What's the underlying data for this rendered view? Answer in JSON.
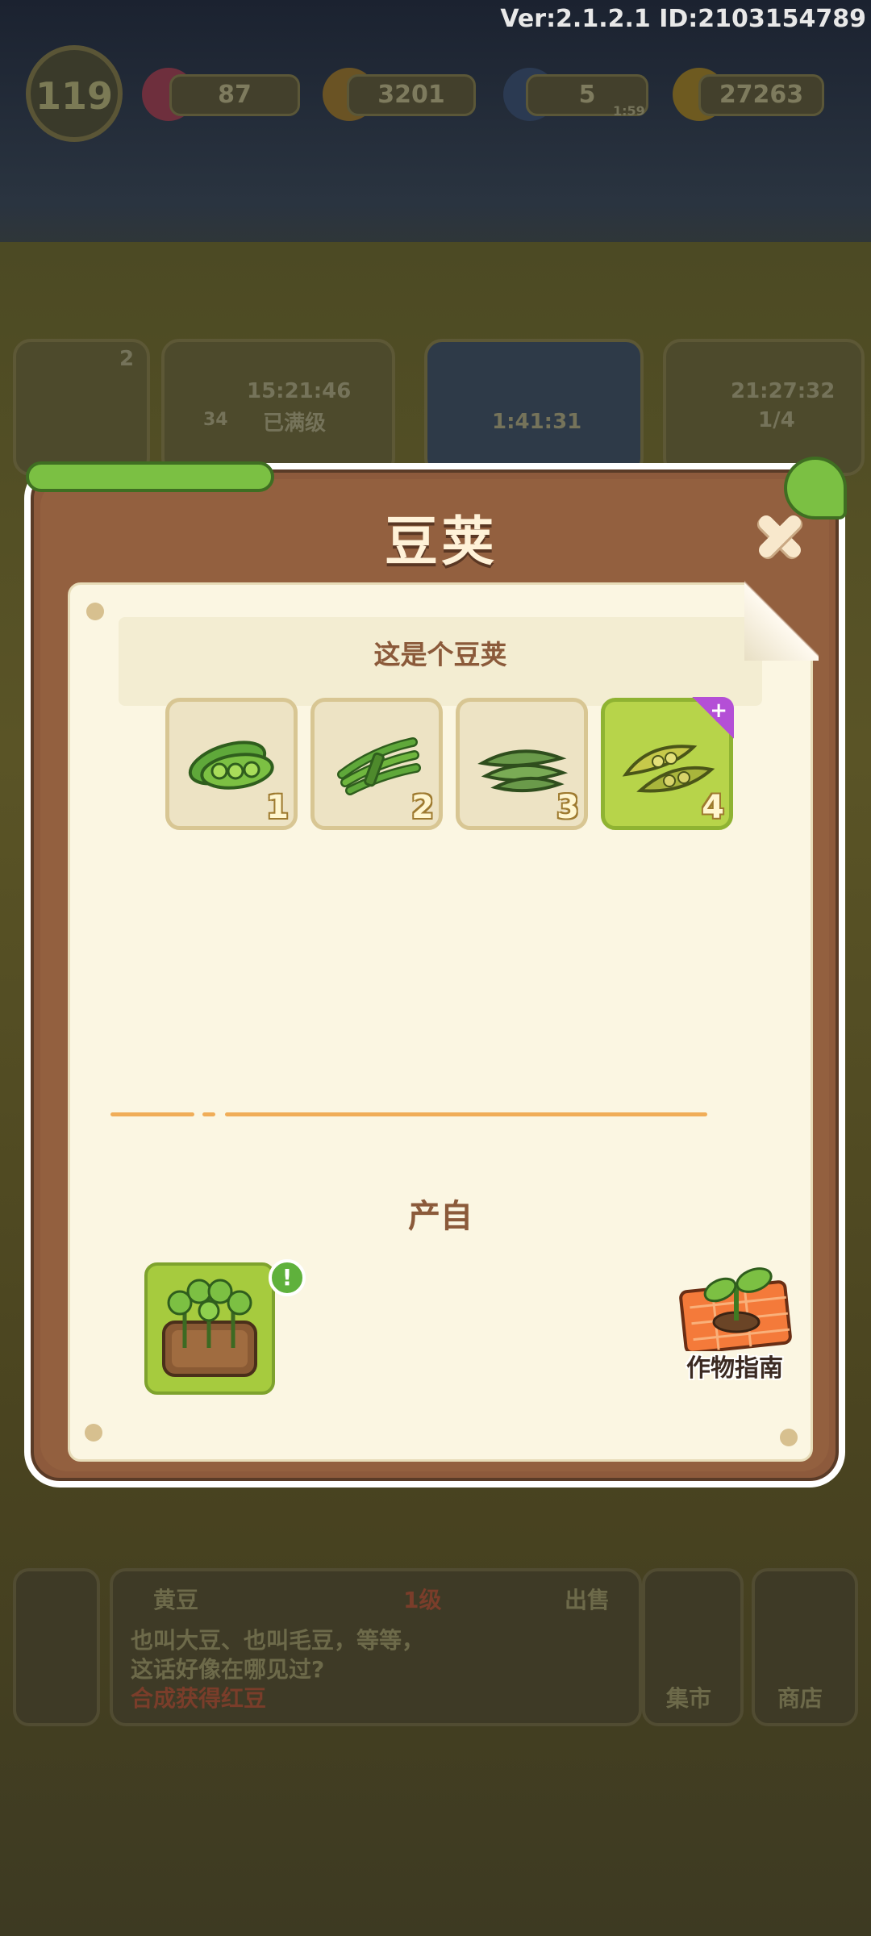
{
  "version_info": "Ver:2.1.2.1 ID:2103154789",
  "hud": {
    "level": "119",
    "gems": "87",
    "carrots": "3201",
    "energy": "5",
    "energy_timer": "1:59",
    "coins": "27263"
  },
  "background": {
    "timer_1": "15:21:46",
    "status_1": "已满级",
    "badge_count": "2",
    "small_count": "34",
    "timer_2": "1:41:31",
    "timer_3": "21:27:32",
    "progress_3": "1/4",
    "bottom": {
      "item_name": "黄豆",
      "item_level": "1级",
      "sell_label": "出售",
      "description_1": "也叫大豆、也叫毛豆，等等，",
      "description_2": "这话好像在哪见过?",
      "compose_hint": "合成获得红豆",
      "market_label": "集市",
      "shop_label": "商店"
    }
  },
  "dialog": {
    "title": "豆荚",
    "subtitle": "这是个豆荚",
    "stages": [
      {
        "num": "1",
        "icon": "pea-pods-icon",
        "selected": false
      },
      {
        "num": "2",
        "icon": "green-bean-bundle-icon",
        "selected": false
      },
      {
        "num": "3",
        "icon": "snow-pea-icon",
        "selected": false
      },
      {
        "num": "4",
        "icon": "soybean-pods-icon",
        "selected": true,
        "new": true
      }
    ],
    "produce_label": "产自",
    "source_icon": "soybean-field-icon",
    "guide_label": "作物指南"
  },
  "colors": {
    "dialog_frame": "#8d5a3c",
    "paper": "#fbf6e2",
    "selected_slot": "#b7d44a",
    "divider": "#f0ad58",
    "title_text": "#fff2d8"
  }
}
